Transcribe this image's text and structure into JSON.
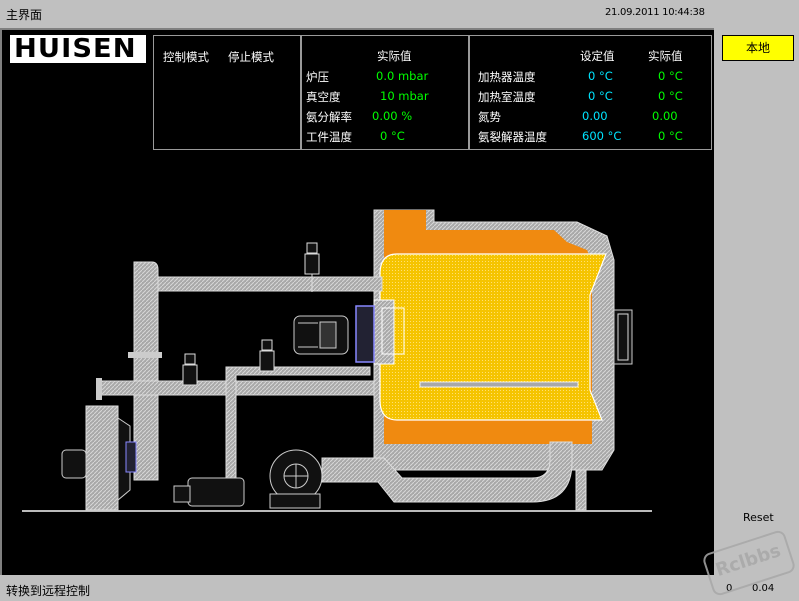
{
  "window": {
    "title": "主界面",
    "datetime": "21.09.2011 10:44:38"
  },
  "logo": {
    "text": "HUISEN"
  },
  "mode_box": {
    "label": "控制模式",
    "value": "停止模式"
  },
  "process_box": {
    "header_actual": "实际值",
    "rows": [
      {
        "label": "炉压",
        "actual": "0.0 mbar"
      },
      {
        "label": "真空度",
        "actual": "10 mbar"
      },
      {
        "label": "氨分解率",
        "actual": "0.00 %"
      },
      {
        "label": "工件温度",
        "actual": "0 °C"
      }
    ]
  },
  "heater_box": {
    "header_set": "设定值",
    "header_actual": "实际值",
    "rows": [
      {
        "label": "加热器温度",
        "set": "0 °C",
        "actual": "0 °C"
      },
      {
        "label": "加热室温度",
        "set": "0 °C",
        "actual": "0 °C"
      },
      {
        "label": "氮势",
        "set": "0.00",
        "actual": "0.00"
      },
      {
        "label": "氨裂解器温度",
        "set": "600 °C",
        "actual": "0 °C"
      }
    ]
  },
  "buttons": {
    "local": "本地",
    "reset": "Reset"
  },
  "footer": {
    "status": "转换到远程控制",
    "zero": "0",
    "version": "0.04"
  },
  "watermark": "Rclbbs",
  "colors": {
    "panel_bg": "#000000",
    "chrome": "#c0c0c0",
    "actual_value": "#00ff00",
    "set_value": "#00e5ff",
    "furnace_yellow": "#f5c400",
    "insulation_orange": "#f08a10",
    "local_button": "#ffff00"
  }
}
